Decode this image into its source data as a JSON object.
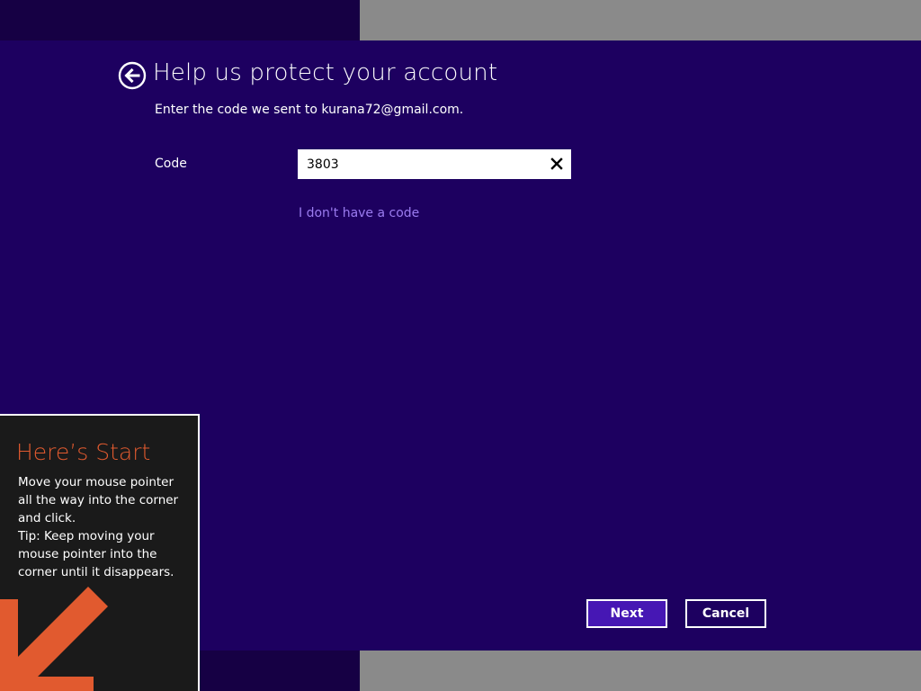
{
  "header": {
    "title": "Help us protect your account",
    "subtitle": "Enter the code we sent to kurana72@gmail.com."
  },
  "form": {
    "code_label": "Code",
    "code_value": "3803",
    "no_code_link": "I don't have a code"
  },
  "buttons": {
    "next_label": "Next",
    "cancel_label": "Cancel"
  },
  "tip": {
    "title": "Here’s Start",
    "lines": [
      "Move your mouse pointer",
      "all the way into the corner",
      "and click.",
      "Tip: Keep moving your",
      "mouse pointer into the",
      "corner until it disappears."
    ]
  },
  "icons": {
    "back": "back-arrow-circle-icon",
    "clear": "close-x-icon",
    "corner_arrow": "arrow-down-left-icon"
  },
  "colors": {
    "background": "#1d0060",
    "link": "#9b7cf0",
    "next_button": "#4617b4",
    "tip_title": "#e15a2f"
  }
}
